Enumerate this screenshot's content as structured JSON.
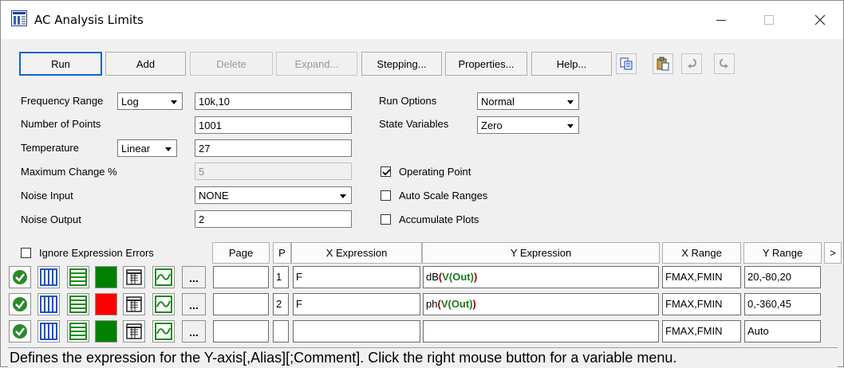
{
  "window": {
    "title": "AC Analysis Limits"
  },
  "toolbar": {
    "run": "Run",
    "add": "Add",
    "delete": "Delete",
    "expand": "Expand...",
    "stepping": "Stepping...",
    "properties": "Properties...",
    "help": "Help..."
  },
  "form": {
    "frequency_range_label": "Frequency Range",
    "frequency_range_mode": "Log",
    "frequency_range_value": "10k,10",
    "number_of_points_label": "Number of Points",
    "number_of_points_value": "1001",
    "temperature_label": "Temperature",
    "temperature_mode": "Linear",
    "temperature_value": "27",
    "maximum_change_label": "Maximum Change %",
    "maximum_change_value": "5",
    "noise_input_label": "Noise Input",
    "noise_input_value": "NONE",
    "noise_output_label": "Noise Output",
    "noise_output_value": "2",
    "run_options_label": "Run Options",
    "run_options_value": "Normal",
    "state_variables_label": "State Variables",
    "state_variables_value": "Zero",
    "operating_point_label": "Operating Point",
    "operating_point_checked": true,
    "auto_scale_label": "Auto Scale Ranges",
    "auto_scale_checked": false,
    "accumulate_label": "Accumulate Plots",
    "accumulate_checked": false
  },
  "grid": {
    "ignore_errors_label": "Ignore Expression Errors",
    "headers": {
      "page": "Page",
      "p": "P",
      "x_expression": "X Expression",
      "y_expression": "Y Expression",
      "x_range": "X Range",
      "y_range": "Y Range",
      "more": ">"
    },
    "dots_label": "...",
    "rows": [
      {
        "color": "#008000",
        "page": "",
        "p": "1",
        "x_expr": "F",
        "y_fn": "dB",
        "y_inner": "V(Out)",
        "x_range": "FMAX,FMIN",
        "y_range": "20,-80,20"
      },
      {
        "color": "#ff0000",
        "page": "",
        "p": "2",
        "x_expr": "F",
        "y_fn": "ph",
        "y_inner": "V(Out)",
        "x_range": "FMAX,FMIN",
        "y_range": "0,-360,45"
      },
      {
        "color": "#008000",
        "page": "",
        "p": "",
        "x_expr": "",
        "y_fn": "",
        "y_inner": "",
        "x_range": "FMAX,FMIN",
        "y_range": "Auto"
      }
    ]
  },
  "status_bar": {
    "text": "Defines the expression for the Y-axis[,Alias][;Comment]. Click the right mouse button for a variable menu."
  }
}
